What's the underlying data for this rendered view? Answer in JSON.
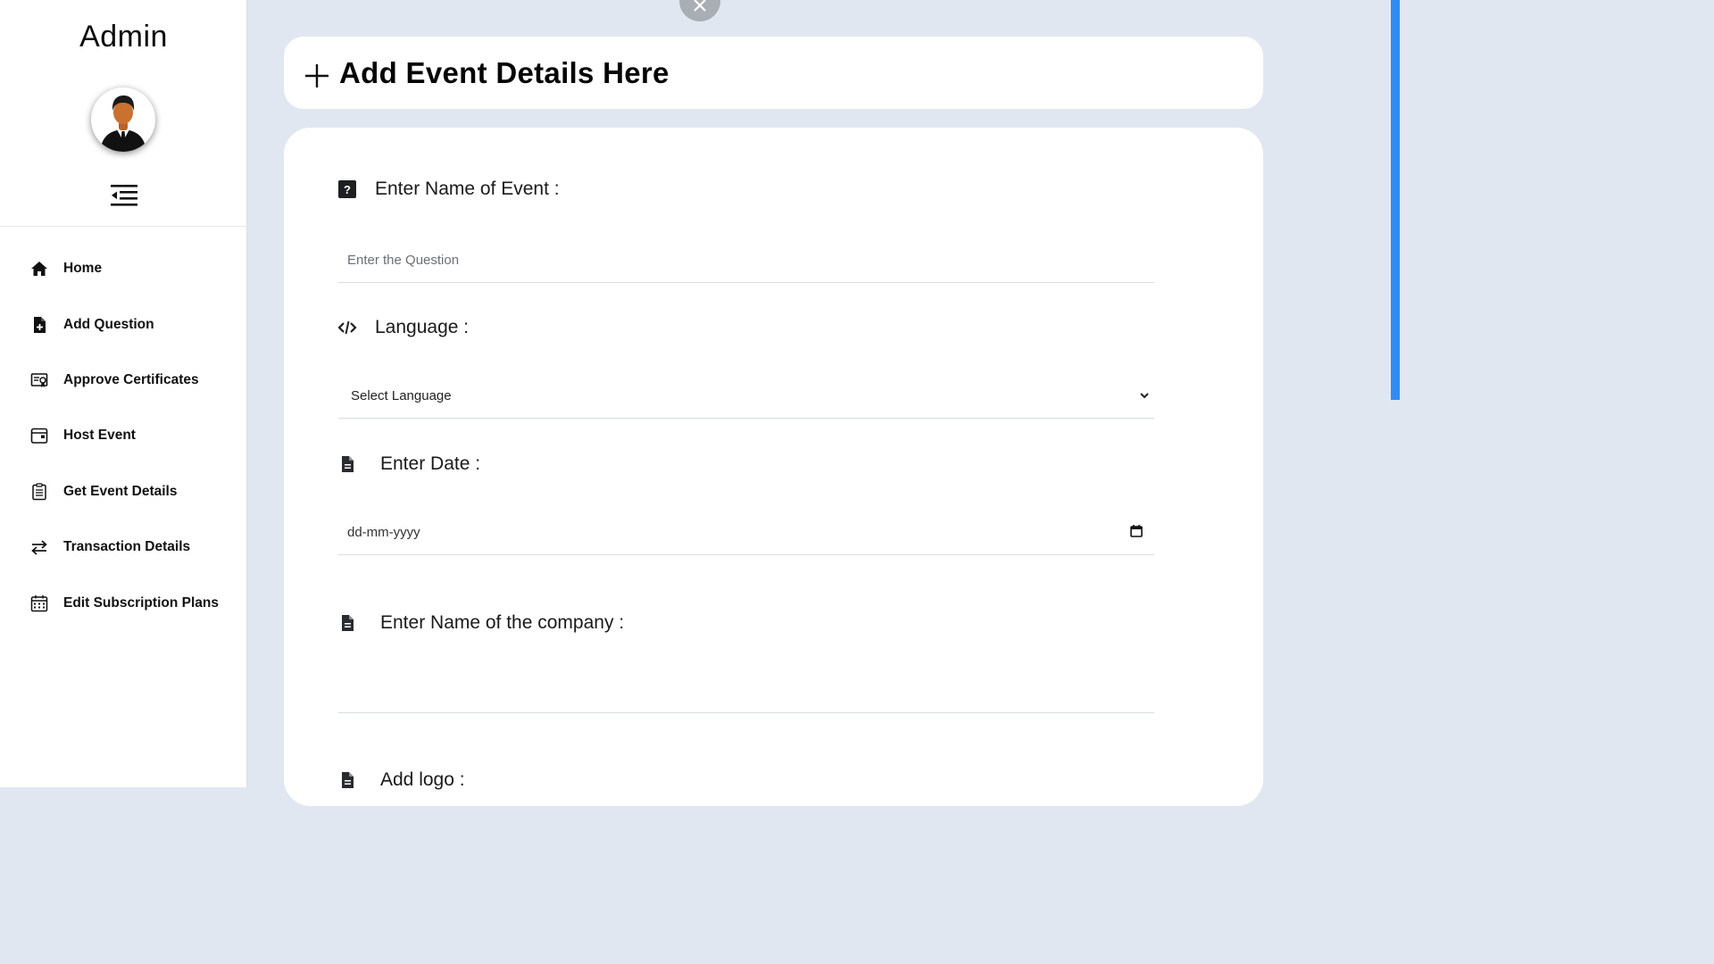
{
  "sidebar": {
    "brand": "Admin",
    "avatar_icon": "user-avatar-icon",
    "menu_toggle_icon": "menu-collapse-icon",
    "items": [
      {
        "label": "Home",
        "icon": "home-icon"
      },
      {
        "label": "Add Question",
        "icon": "add-document-icon"
      },
      {
        "label": "Approve Certificates",
        "icon": "certificate-icon"
      },
      {
        "label": "Host Event",
        "icon": "calendar-window-icon"
      },
      {
        "label": "Get Event Details",
        "icon": "clipboard-list-icon"
      },
      {
        "label": "Transaction Details",
        "icon": "swap-arrows-icon"
      },
      {
        "label": "Edit Subscription Plans",
        "icon": "calendar-grid-icon"
      }
    ]
  },
  "header": {
    "title": "Add Event Details Here",
    "icon": "plus-icon"
  },
  "form": {
    "event_name": {
      "label": "Enter Name of Event :",
      "icon": "question-square-icon",
      "placeholder": "Enter the Question",
      "value": ""
    },
    "language": {
      "label": "Language :",
      "icon": "code-icon",
      "selected": "Select Language"
    },
    "date": {
      "label": "Enter Date :",
      "icon": "file-icon",
      "value": "dd-mm-yyyy"
    },
    "company": {
      "label": "Enter Name of the company :",
      "icon": "file-icon",
      "value": ""
    },
    "logo": {
      "label": "Add logo :",
      "icon": "file-icon"
    }
  },
  "colors": {
    "page_bg": "#e1e7f0",
    "card_bg": "#ffffff",
    "scrollbar": "#2f8cf6",
    "close_button": "#a9aeb5"
  }
}
